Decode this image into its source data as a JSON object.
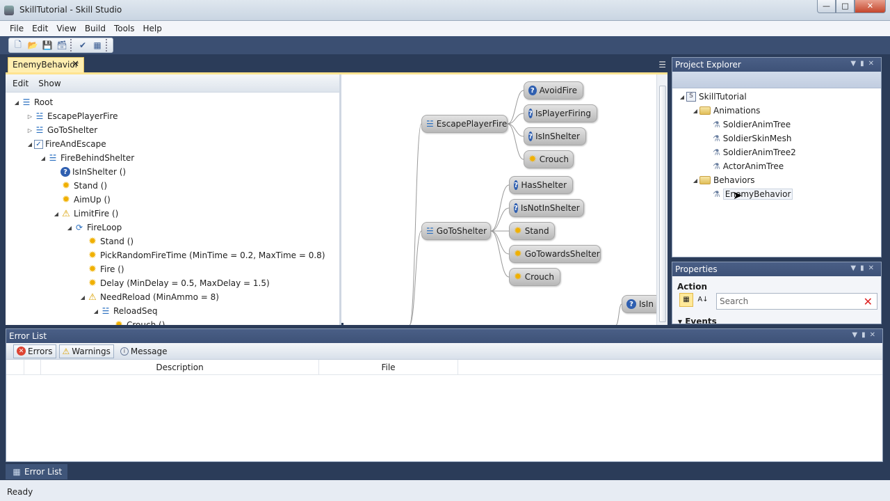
{
  "window": {
    "title": "SkillTutorial - Skill Studio"
  },
  "menu": [
    "File",
    "Edit",
    "View",
    "Build",
    "Tools",
    "Help"
  ],
  "doc_tab": {
    "label": "EnemyBehavior"
  },
  "tree_toolbar": {
    "edit": "Edit",
    "show": "Show"
  },
  "tree": [
    {
      "label": "Root",
      "icon": "root-list-icon",
      "depth": 0,
      "expander": "open"
    },
    {
      "label": "EscapePlayerFire",
      "icon": "sequence-icon",
      "depth": 1,
      "expander": "closed"
    },
    {
      "label": "GoToShelter",
      "icon": "sequence-icon",
      "depth": 1,
      "expander": "closed"
    },
    {
      "label": "FireAndEscape",
      "icon": "checkbox-icon",
      "depth": 1,
      "expander": "open"
    },
    {
      "label": "FireBehindShelter",
      "icon": "sequence-icon",
      "depth": 2,
      "expander": "open"
    },
    {
      "label": "IsInShelter ()",
      "icon": "condition-icon",
      "depth": 3,
      "expander": "none"
    },
    {
      "label": "Stand ()",
      "icon": "action-icon",
      "depth": 3,
      "expander": "none"
    },
    {
      "label": "AimUp ()",
      "icon": "action-icon",
      "depth": 3,
      "expander": "none"
    },
    {
      "label": "LimitFire ()",
      "icon": "warning-icon",
      "depth": 3,
      "expander": "open"
    },
    {
      "label": "FireLoop",
      "icon": "loop-icon",
      "depth": 4,
      "expander": "open"
    },
    {
      "label": "Stand ()",
      "icon": "action-icon",
      "depth": 5,
      "expander": "none"
    },
    {
      "label": "PickRandomFireTime (MinTime = 0.2, MaxTime = 0.8)",
      "icon": "action-icon",
      "depth": 5,
      "expander": "none"
    },
    {
      "label": "Fire ()",
      "icon": "action-icon",
      "depth": 5,
      "expander": "none"
    },
    {
      "label": "Delay (MinDelay = 0.5, MaxDelay = 1.5)",
      "icon": "action-icon",
      "depth": 5,
      "expander": "none"
    },
    {
      "label": "NeedReload (MinAmmo = 8)",
      "icon": "warning-icon",
      "depth": 5,
      "expander": "open"
    },
    {
      "label": "ReloadSeq",
      "icon": "sequence-icon",
      "depth": 6,
      "expander": "open"
    },
    {
      "label": "Crouch ()",
      "icon": "action-icon",
      "depth": 7,
      "expander": "none"
    }
  ],
  "graph_nodes": [
    {
      "label": "EscapePlayerFire",
      "icon": "sequence-icon"
    },
    {
      "label": "AvoidFire",
      "icon": "condition-icon"
    },
    {
      "label": "IsPlayerFiring",
      "icon": "condition-icon"
    },
    {
      "label": "IsInShelter",
      "icon": "condition-icon"
    },
    {
      "label": "Crouch",
      "icon": "action-icon"
    },
    {
      "label": "GoToShelter",
      "icon": "sequence-icon"
    },
    {
      "label": "HasShelter",
      "icon": "condition-icon"
    },
    {
      "label": "IsNotInShelter",
      "icon": "condition-icon"
    },
    {
      "label": "Stand",
      "icon": "action-icon"
    },
    {
      "label": "GoTowardsShelter",
      "icon": "action-icon"
    },
    {
      "label": "Crouch",
      "icon": "action-icon"
    },
    {
      "label": "IsIn",
      "icon": "condition-icon"
    }
  ],
  "project_explorer": {
    "title": "Project Explorer",
    "items": [
      {
        "label": "SkillTutorial",
        "kind": "project"
      },
      {
        "label": "Animations",
        "kind": "folder"
      },
      {
        "label": "SoldierAnimTree",
        "kind": "anim"
      },
      {
        "label": "SoldierSkinMesh",
        "kind": "anim"
      },
      {
        "label": "SoldierAnimTree2",
        "kind": "anim"
      },
      {
        "label": "ActorAnimTree",
        "kind": "anim"
      },
      {
        "label": "Behaviors",
        "kind": "folder"
      },
      {
        "label": "EnemyBehavior",
        "kind": "anim"
      }
    ]
  },
  "properties": {
    "title": "Properties",
    "object_type": "Action",
    "search_placeholder": "Search",
    "events_label": "Events"
  },
  "error_list": {
    "title": "Error List",
    "filters": {
      "errors": "Errors",
      "warnings": "Warnings",
      "message": "Message"
    },
    "columns": {
      "description": "Description",
      "file": "File"
    }
  },
  "bottom_tab": "Error List",
  "status": "Ready"
}
